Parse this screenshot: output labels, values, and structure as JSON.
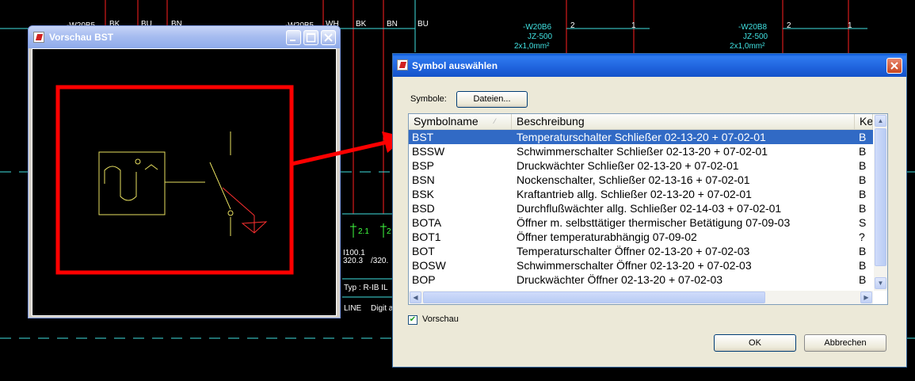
{
  "cad": {
    "wire_labels": [
      "BK",
      "BU",
      "BN",
      "WH",
      "BK",
      "BN",
      "BU"
    ],
    "top_left_fragments": [
      "-W20B5",
      "-W20B5"
    ],
    "cable_1": {
      "name": "-W20B6",
      "type": "JZ-500",
      "section": "2x1,0mm²",
      "pin_a": "2",
      "pin_b": "1"
    },
    "cable_2": {
      "name": "-W20B8",
      "type": "JZ-500",
      "section": "2x1,0mm²",
      "pin_a": "2",
      "pin_b": "1"
    },
    "bg_texts": [
      "2.1",
      "2",
      "I100.1",
      "320.3",
      "/320.",
      "Typ : R-IB IL",
      "LINE",
      "Digit a"
    ]
  },
  "preview": {
    "title": "Vorschau BST"
  },
  "dialog": {
    "title": "Symbol auswählen",
    "symbols_label": "Symbole:",
    "files_button": "Dateien...",
    "columns": [
      "Symbolname",
      "Beschreibung",
      "Ke"
    ],
    "rows": [
      {
        "name": "BST",
        "desc": "Temperaturschalter Schließer 02-13-20 + 07-02-01",
        "ke": "B",
        "selected": true
      },
      {
        "name": "BSSW",
        "desc": "Schwimmerschalter Schließer 02-13-20 + 07-02-01",
        "ke": "B"
      },
      {
        "name": "BSP",
        "desc": "Druckwächter Schließer 02-13-20 + 07-02-01",
        "ke": "B"
      },
      {
        "name": "BSN",
        "desc": "Nockenschalter, Schließer 02-13-16 + 07-02-01",
        "ke": "B"
      },
      {
        "name": "BSK",
        "desc": "Kraftantrieb allg. Schließer 02-13-20 + 07-02-01",
        "ke": "B"
      },
      {
        "name": "BSD",
        "desc": "Durchflußwächter allg. Schließer 02-14-03 + 07-02-01",
        "ke": "B"
      },
      {
        "name": "BOTA",
        "desc": "Öffner m. selbsttätiger thermischer Betätigung 07-09-03",
        "ke": "S"
      },
      {
        "name": "BOT1",
        "desc": "Öffner temperaturabhängig 07-09-02",
        "ke": "?"
      },
      {
        "name": "BOT",
        "desc": "Temperaturschalter Öffner 02-13-20 + 07-02-03",
        "ke": "B"
      },
      {
        "name": "BOSW",
        "desc": "Schwimmerschalter Öffner 02-13-20 + 07-02-03",
        "ke": "B"
      },
      {
        "name": "BOP",
        "desc": "Druckwächter Öffner 02-13-20 + 07-02-03",
        "ke": "B"
      }
    ],
    "preview_checkbox_label": "Vorschau",
    "preview_checked": true,
    "ok_label": "OK",
    "cancel_label": "Abbrechen"
  },
  "colors": {
    "selection": "#316ac5",
    "highlight_red": "#ff0000",
    "cad_yellow": "#e8e060",
    "cad_cyan": "#40e0e0"
  }
}
